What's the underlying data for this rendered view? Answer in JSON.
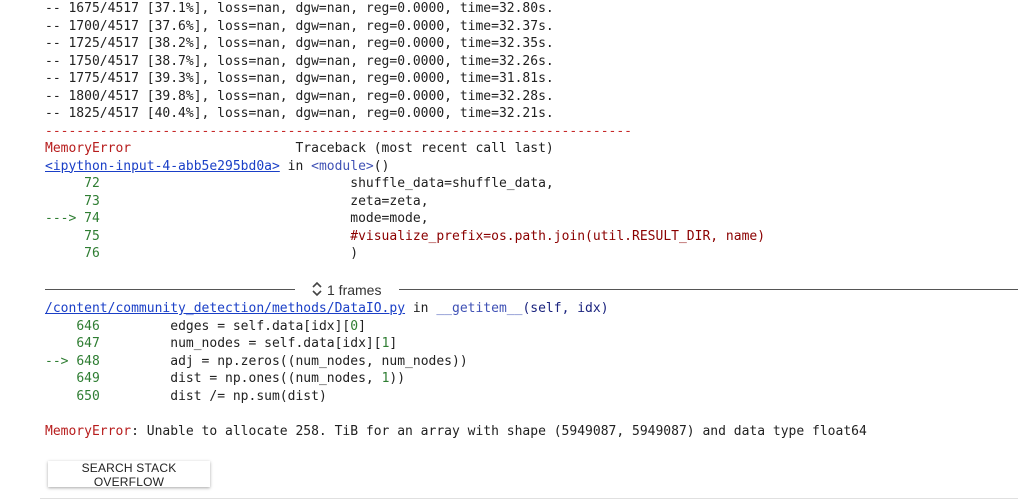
{
  "log_lines": [
    "-- 1675/4517 [37.1%], loss=nan, dgw=nan, reg=0.0000, time=32.80s.",
    "-- 1700/4517 [37.6%], loss=nan, dgw=nan, reg=0.0000, time=32.37s.",
    "-- 1725/4517 [38.2%], loss=nan, dgw=nan, reg=0.0000, time=32.35s.",
    "-- 1750/4517 [38.7%], loss=nan, dgw=nan, reg=0.0000, time=32.26s.",
    "-- 1775/4517 [39.3%], loss=nan, dgw=nan, reg=0.0000, time=31.81s.",
    "-- 1800/4517 [39.8%], loss=nan, dgw=nan, reg=0.0000, time=32.28s.",
    "-- 1825/4517 [40.4%], loss=nan, dgw=nan, reg=0.0000, time=32.21s."
  ],
  "separator": "---------------------------------------------------------------------------",
  "traceback": {
    "error_name": "MemoryError",
    "header": "Traceback (most recent call last)",
    "frame1": {
      "file_link": "<ipython-input-4-abb5e295bd0a>",
      "in_text": " in ",
      "module": "<module>",
      "paren": "()",
      "lines": [
        {
          "arrow": "    ",
          "num": " 72",
          "code": "                                shuffle_data=shuffle_data,"
        },
        {
          "arrow": "    ",
          "num": " 73",
          "code": "                                zeta=zeta,"
        },
        {
          "arrow": "---> ",
          "num": "74",
          "code": "                                mode=mode,"
        },
        {
          "arrow": "    ",
          "num": " 75",
          "code": "                                ",
          "comment": "#visualize_prefix=os.path.join(util.RESULT_DIR, name)"
        },
        {
          "arrow": "    ",
          "num": " 76",
          "code": "                                )"
        }
      ]
    },
    "frames_label": "1 frames",
    "frame2": {
      "file_link": "/content/community_detection/methods/DataIO.py",
      "in_text": " in ",
      "func": "__getitem__",
      "args": "(self, idx)",
      "lines": [
        {
          "arrow": "    ",
          "num": "646",
          "pre": "         edges = self.data[idx][",
          "lit": "0",
          "post": "]"
        },
        {
          "arrow": "    ",
          "num": "647",
          "pre": "         num_nodes = self.data[idx][",
          "lit": "1",
          "post": "]"
        },
        {
          "arrow": "--> ",
          "num": "648",
          "pre": "         adj = np.zeros((num_nodes, num_nodes))",
          "lit": "",
          "post": ""
        },
        {
          "arrow": "    ",
          "num": "649",
          "pre": "         dist = np.ones((num_nodes, ",
          "lit": "1",
          "post": "))"
        },
        {
          "arrow": "    ",
          "num": "650",
          "pre": "         dist /= np.sum(dist)",
          "lit": "",
          "post": ""
        }
      ]
    },
    "final_error_name": "MemoryError",
    "final_error_msg": ": Unable to allocate 258. TiB for an array with shape (5949087, 5949087) and data type float64"
  },
  "search_button_label": "SEARCH STACK OVERFLOW",
  "colors": {
    "error_red": "#b71c1c",
    "link_blue": "#1a3fc7",
    "line_number_green": "#2e7d32",
    "comment_maroon": "#8b0000"
  }
}
